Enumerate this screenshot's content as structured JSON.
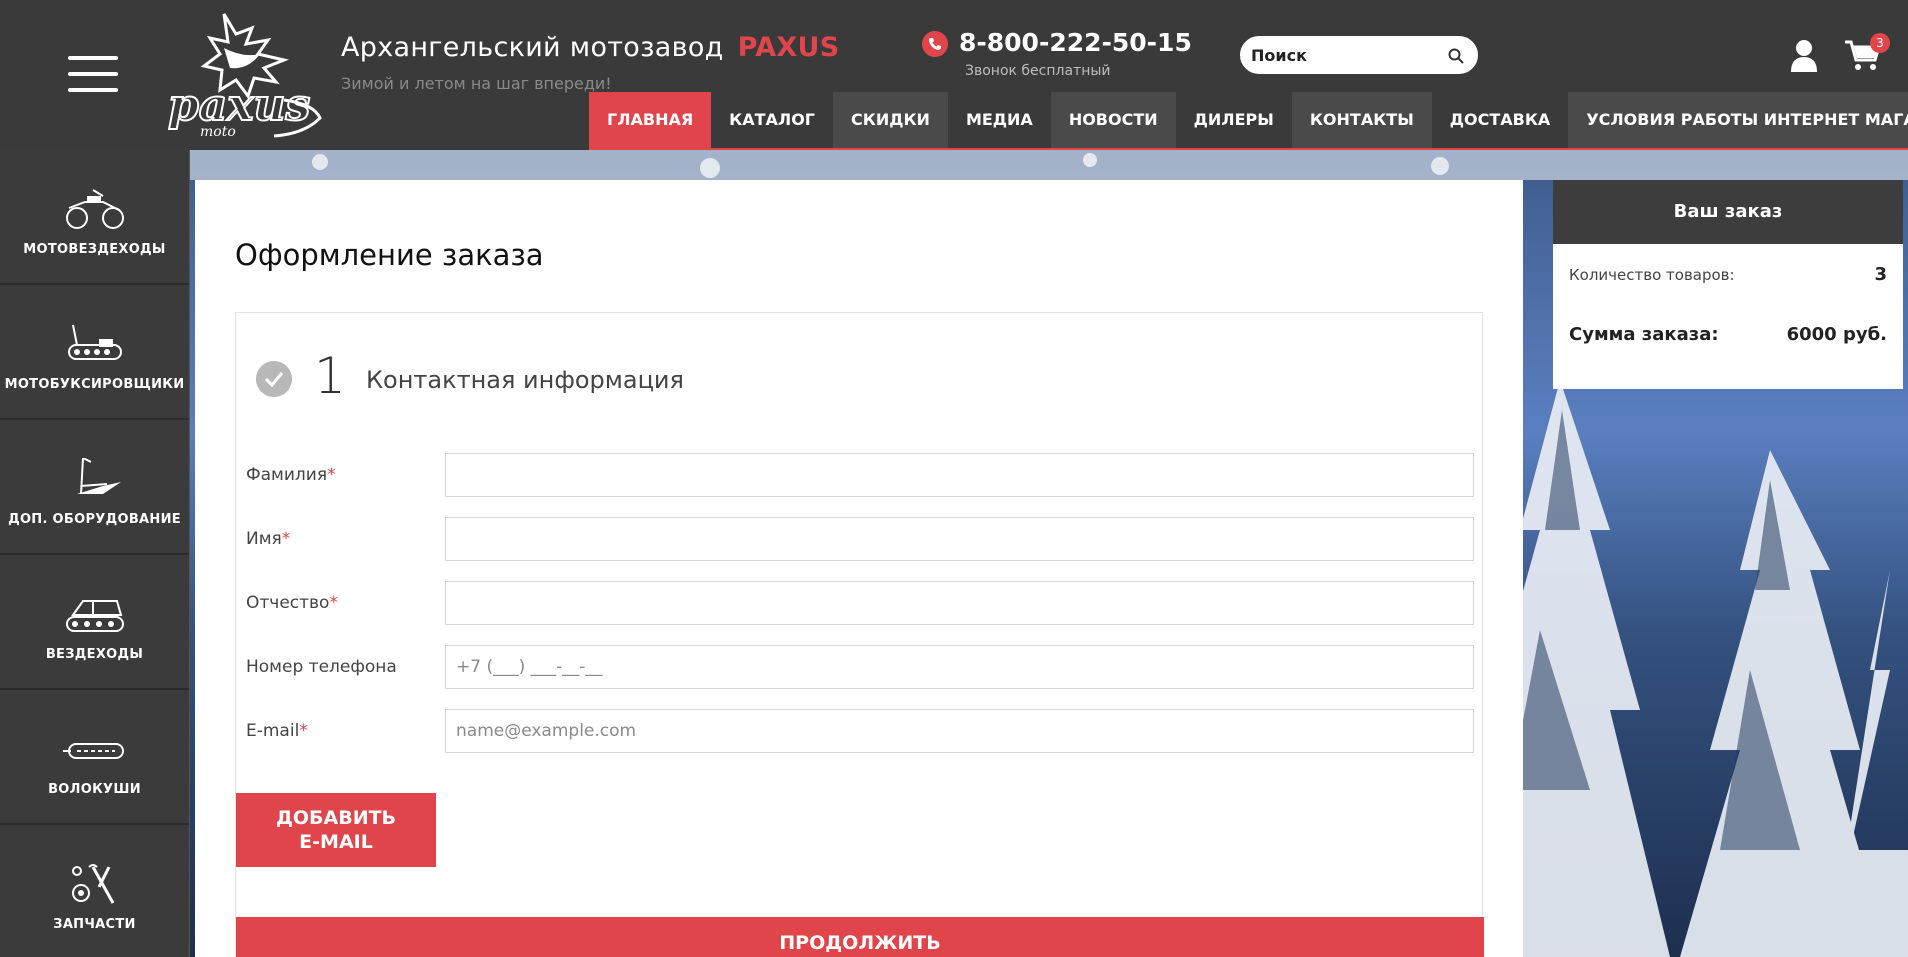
{
  "header": {
    "site_name": "Архангельский мотозавод",
    "brand": "PAXUS",
    "tagline": "Зимой и летом на шаг впереди!",
    "phone": "8-800-222-50-15",
    "phone_note": "Звонок бесплатный",
    "search_placeholder": "Поиск",
    "cart_count": "3"
  },
  "nav": [
    {
      "label": "ГЛАВНАЯ"
    },
    {
      "label": "КАТАЛОГ"
    },
    {
      "label": "СКИДКИ"
    },
    {
      "label": "МЕДИА"
    },
    {
      "label": "НОВОСТИ"
    },
    {
      "label": "ДИЛЕРЫ"
    },
    {
      "label": "КОНТАКТЫ"
    },
    {
      "label": "ДОСТАВКА"
    },
    {
      "label": "УСЛОВИЯ РАБОТЫ ИНТЕРНЕТ МАГАЗИНА"
    }
  ],
  "sidebar": [
    {
      "label": "МОТОВЕЗДЕХОДЫ",
      "icon": "atv-icon"
    },
    {
      "label": "МОТОБУКСИРОВЩИКИ",
      "icon": "snow-tug-icon"
    },
    {
      "label": "ДОП. ОБОРУДОВАНИЕ",
      "icon": "plow-icon"
    },
    {
      "label": "ВЕЗДЕХОДЫ",
      "icon": "tracked-vehicle-icon"
    },
    {
      "label": "ВОЛОКУШИ",
      "icon": "sled-icon"
    },
    {
      "label": "ЗАПЧАСТИ",
      "icon": "parts-icon"
    }
  ],
  "checkout": {
    "title": "Оформление заказа",
    "step_number": "1",
    "step_title": "Контактная информация",
    "fields": [
      {
        "label": "Фамилия",
        "required": "*",
        "value": "",
        "placeholder": ""
      },
      {
        "label": "Имя",
        "required": "*",
        "value": "",
        "placeholder": ""
      },
      {
        "label": "Отчество",
        "required": "*",
        "value": "",
        "placeholder": ""
      },
      {
        "label": "Номер телефона",
        "required": "",
        "value": "",
        "placeholder": "+7 (___) ___-__-__"
      },
      {
        "label": "E-mail",
        "required": "*",
        "value": "",
        "placeholder": "name@example.com"
      }
    ],
    "add_email_line1": "ДОБАВИТЬ",
    "add_email_line2": "E-MAIL",
    "continue_label": "ПРОДОЛЖИТЬ"
  },
  "summary": {
    "title": "Ваш заказ",
    "qty_label": "Количество товаров:",
    "qty_value": "3",
    "total_label": "Сумма заказа:",
    "total_value": "6000 руб."
  },
  "colors": {
    "accent": "#e0454c",
    "header_bg": "#3a3a3a",
    "sidebar_bg": "#3b3b3b"
  }
}
